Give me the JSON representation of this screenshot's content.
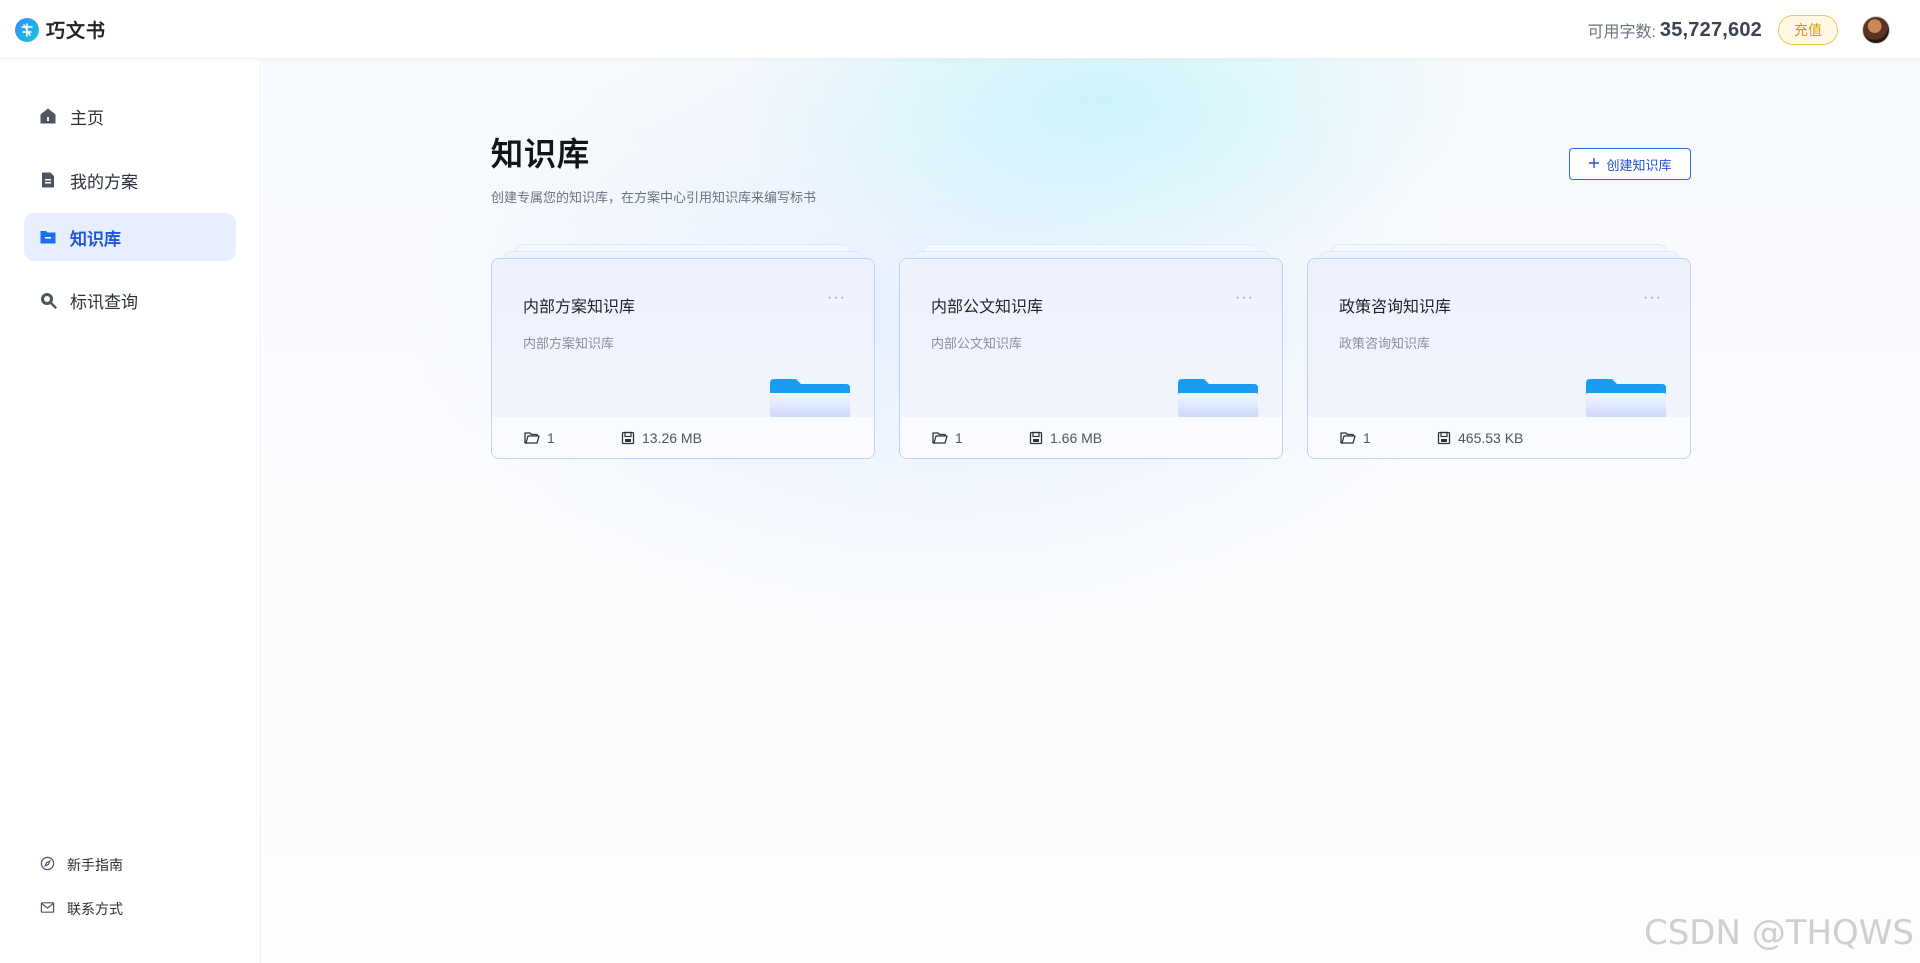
{
  "header": {
    "app_name": "巧文书",
    "quota_label": "可用字数:",
    "quota_value": "35,727,602",
    "recharge_label": "充值"
  },
  "sidebar": {
    "items": [
      {
        "label": "主页",
        "icon": "home-icon"
      },
      {
        "label": "我的方案",
        "icon": "document-icon"
      },
      {
        "label": "知识库",
        "icon": "folder-icon",
        "active": true
      },
      {
        "label": "标讯查询",
        "icon": "search-icon"
      }
    ],
    "bottom": [
      {
        "label": "新手指南",
        "icon": "compass-icon"
      },
      {
        "label": "联系方式",
        "icon": "mail-icon"
      }
    ]
  },
  "main": {
    "title": "知识库",
    "subtitle": "创建专属您的知识库，在方案中心引用知识库来编写标书",
    "create_label": "创建知识库",
    "cards": [
      {
        "title": "内部方案知识库",
        "desc": "内部方案知识库",
        "count": "1",
        "size": "13.26 MB"
      },
      {
        "title": "内部公文知识库",
        "desc": "内部公文知识库",
        "count": "1",
        "size": "1.66 MB"
      },
      {
        "title": "政策咨询知识库",
        "desc": "政策咨询知识库",
        "count": "1",
        "size": "465.53 KB"
      }
    ],
    "more_label": "···"
  },
  "watermark": "CSDN @THQWS",
  "colors": {
    "accent": "#1f55d6",
    "active_bg": "#e7effe",
    "recharge_border": "#f2c45a",
    "folder_blue": "#1a9cf0"
  }
}
